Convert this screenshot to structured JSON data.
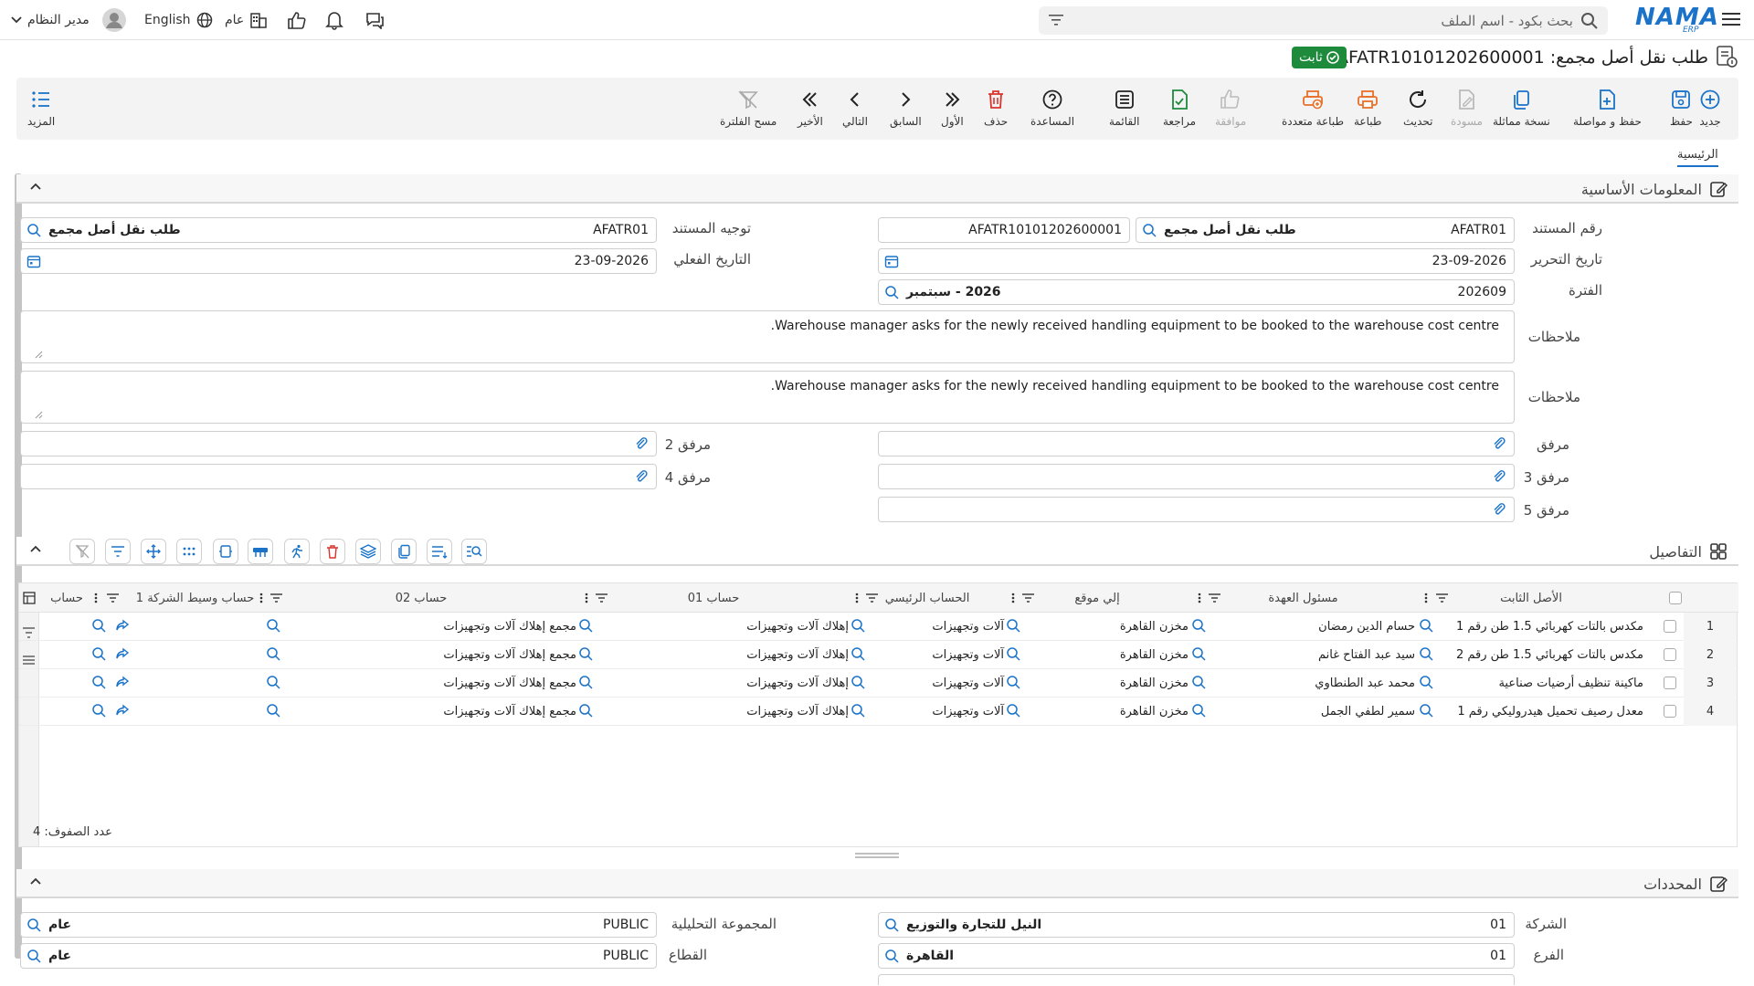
{
  "topbar": {
    "brand": "NAMA",
    "brand_sub": "ERP",
    "search_placeholder": "بحث بكود - اسم الملف",
    "language": "English",
    "scope": "عام",
    "user": "مدير النظام"
  },
  "page": {
    "title": "طلب نقل أصل مجمع: AFATR10101202600001",
    "status": "ثابت"
  },
  "toolbar": {
    "new": "جديد",
    "save": "حفظ",
    "save_continue": "حفظ و مواصلة",
    "duplicate": "نسخة مماثلة",
    "draft": "مسودة",
    "refresh": "تحديث",
    "print": "طباعة",
    "multi_print": "طباعة متعددة",
    "approve": "موافقة",
    "review": "مراجعة",
    "list": "القائمة",
    "help": "المساعدة",
    "delete": "حذف",
    "first": "الأول",
    "previous": "السابق",
    "next": "التالي",
    "last": "الأخير",
    "clear_filter": "مسح الفلترة",
    "more": "المزيد"
  },
  "tabs": {
    "home": "الرئيسية"
  },
  "basic": {
    "title": "المعلومات الأساسية",
    "doc_number_label": "رقم المستند",
    "doc_code": "AFATR01",
    "doc_type": "طلب نقل أصل مجمع",
    "doc_number": "AFATR10101202600001",
    "doc_route_label": "توجيه المستند",
    "route_code": "AFATR01",
    "route_name": "طلب نقل أصل مجمع",
    "edit_date_label": "تاريخ التحرير",
    "edit_date": "23-09-2026",
    "actual_date_label": "التاريخ الفعلي",
    "actual_date": "23-09-2026",
    "period_label": "الفترة",
    "period_code": "202609",
    "period_name": "2026 - سبتمبر",
    "notes_label": "ملاحظات",
    "notes1": "Warehouse manager asks for the newly received handling equipment to be booked to the warehouse cost centre.",
    "notes2": "Warehouse manager asks for the newly received handling equipment to be booked to the warehouse cost centre.",
    "attach_label": "مرفق",
    "attach2_label": "مرفق 2",
    "attach3_label": "مرفق 3",
    "attach4_label": "مرفق 4",
    "attach5_label": "مرفق 5"
  },
  "details": {
    "title": "التفاصيل",
    "columns": {
      "asset": "الأصل الثابت",
      "custodian": "مسئول العهدة",
      "to_location": "إلي موقع",
      "main_account": "الحساب الرئيسي",
      "account01": "حساب 01",
      "account02": "حساب 02",
      "intermediary": "حساب وسيط الشركة 1",
      "account": "حساب"
    },
    "rows": [
      {
        "n": "1",
        "asset": "مكدس بالتات كهربائي 1.5 طن رقم 1",
        "custodian": "حسام الدين رمضان",
        "location": "مخزن القاهرة",
        "main": "آلات وتجهيزات",
        "a01": "إهلاك آلات وتجهيزات",
        "a02": "مجمع إهلاك آلات وتجهيزات"
      },
      {
        "n": "2",
        "asset": "مكدس بالتات كهربائي 1.5 طن رقم 2",
        "custodian": "سيد عبد الفتاح غانم",
        "location": "مخزن القاهرة",
        "main": "آلات وتجهيزات",
        "a01": "إهلاك آلات وتجهيزات",
        "a02": "مجمع إهلاك آلات وتجهيزات"
      },
      {
        "n": "3",
        "asset": "ماكينة تنظيف أرضيات صناعية",
        "custodian": "محمد عبد الطنطاوي",
        "location": "مخزن القاهرة",
        "main": "آلات وتجهيزات",
        "a01": "إهلاك آلات وتجهيزات",
        "a02": "مجمع إهلاك آلات وتجهيزات"
      },
      {
        "n": "4",
        "asset": "معدل رصيف تحميل هيدروليكي رقم 1",
        "custodian": "سمير لطفي الجمل",
        "location": "مخزن القاهرة",
        "main": "آلات وتجهيزات",
        "a01": "إهلاك آلات وتجهيزات",
        "a02": "مجمع إهلاك آلات وتجهيزات"
      }
    ],
    "row_count": "عدد الصفوف: 4"
  },
  "dimensions": {
    "title": "المحددات",
    "company_label": "الشركة",
    "company_code": "01",
    "company_name": "النيل للتجارة والتوزيع",
    "analytic_label": "المجموعة التحليلية",
    "analytic_code": "PUBLIC",
    "analytic_name": "عام",
    "branch_label": "الفرع",
    "branch_code": "01",
    "branch_name": "القاهرة",
    "sector_label": "القطاع",
    "sector_code": "PUBLIC",
    "sector_name": "عام"
  },
  "colors": {
    "brand": "#1a73c9",
    "status": "#1e8a3c",
    "danger": "#d9342b",
    "accent_orange": "#e8702a",
    "icon_blue": "#1a73c9"
  }
}
